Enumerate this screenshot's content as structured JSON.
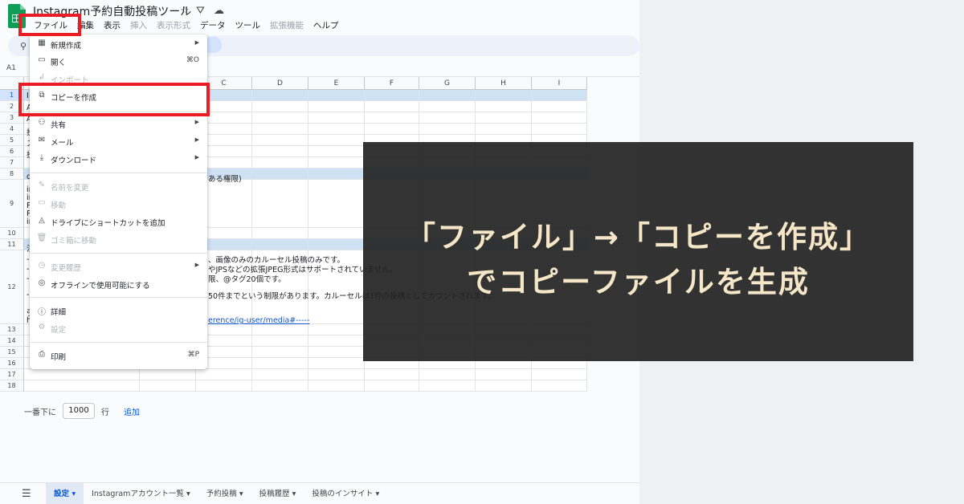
{
  "app": {
    "title": "Instagram予約自動投稿ツール",
    "name_box": "A1"
  },
  "menubar": [
    {
      "label": "ファイル",
      "disabled": false
    },
    {
      "label": "編集",
      "disabled": false
    },
    {
      "label": "表示",
      "disabled": false
    },
    {
      "label": "挿入",
      "disabled": true
    },
    {
      "label": "表示形式",
      "disabled": true
    },
    {
      "label": "データ",
      "disabled": false
    },
    {
      "label": "ツール",
      "disabled": false
    },
    {
      "label": "拡張機能",
      "disabled": true
    },
    {
      "label": "ヘルプ",
      "disabled": false
    }
  ],
  "file_menu": {
    "new": "新規作成",
    "open": "開く",
    "open_shortcut": "⌘O",
    "import": "インポート",
    "make_copy": "コピーを作成",
    "share": "共有",
    "email": "メール",
    "download": "ダウンロード",
    "rename": "名前を変更",
    "move": "移動",
    "add_shortcut": "ドライブにショートカットを追加",
    "trash": "ゴミ箱に移動",
    "version_history": "変更履歴",
    "offline": "オフラインで使用可能にする",
    "details": "詳細",
    "settings": "設定",
    "print": "印刷",
    "print_shortcut": "⌘P"
  },
  "columns": [
    "C",
    "D",
    "E",
    "F",
    "G",
    "H",
    "I"
  ],
  "rows": [
    "1",
    "2",
    "3",
    "4",
    "5",
    "6",
    "7",
    "8",
    "9",
    "10",
    "11",
    "12",
    "13",
    "14",
    "15",
    "16",
    "17",
    "18"
  ],
  "sheet": {
    "row1_fragment": "I",
    "row2_fragment": "A",
    "row3_fragment": "A",
    "row4_fragment": "投",
    "row5_fragment": "ス",
    "row6_fragment": "投",
    "row8_fragment": "d",
    "row8_text": "ある権限)",
    "row9_fragment_a": "in",
    "row9_fragment_b": "in",
    "row9_fragment_c": "P",
    "row9_fragment_d": "P",
    "row9_fragment_e": "in",
    "row11_fragment": "注",
    "row12_line1": "、画像のみのカルーセル投稿のみです。",
    "row12_line2": "やJPSなどの拡張JPEG形式はサポートされていません。",
    "row12_line3": "限、@タグ20個です。",
    "row12_line4": "50件までという制限があります。カルーセルは1件の投稿としてカウントされます。",
    "row12_frag_a": "-",
    "row12_frag_b": "-",
    "row12_frag_c": "-",
    "row12_frag_d": "-",
    "row12_frag_e": "引",
    "row12_frag_f": "h",
    "row12_link": "erence/ig-user/media#-----"
  },
  "add_rows": {
    "prefix": "一番下に",
    "value": "1000",
    "suffix": "行",
    "button": "追加"
  },
  "tabs": [
    {
      "label": "設定",
      "active": true
    },
    {
      "label": "Instagramアカウント一覧",
      "active": false
    },
    {
      "label": "予約投稿",
      "active": false
    },
    {
      "label": "投稿履歴",
      "active": false
    },
    {
      "label": "投稿のインサイト",
      "active": false
    }
  ],
  "overlay": {
    "line1": "「ファイル」→「コピーを作成」",
    "line2": "でコピーファイルを生成"
  },
  "colors": {
    "highlight": "#ec1c24",
    "overlay_bg": "#222222",
    "overlay_text": "#f5e6c8",
    "accent": "#0b57d0"
  }
}
